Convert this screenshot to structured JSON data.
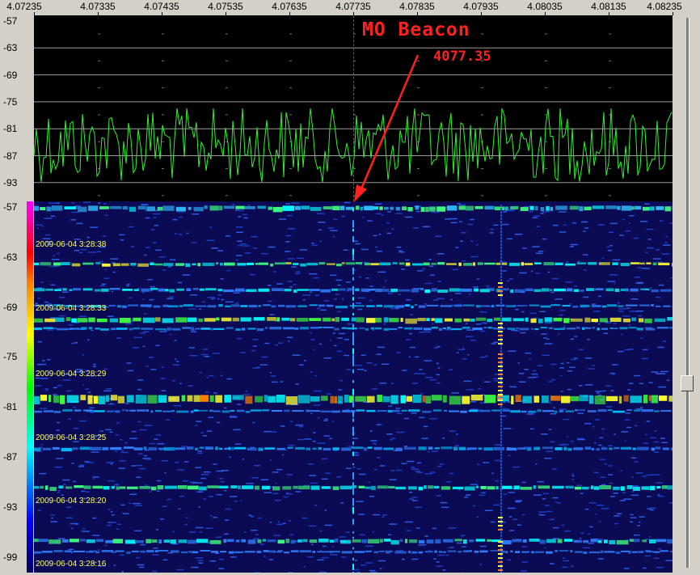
{
  "frequency_axis": {
    "labels": [
      "4.07235",
      "4.07335",
      "4.07435",
      "4.07535",
      "4.07635",
      "4.07735",
      "4.07835",
      "4.07935",
      "4.08035",
      "4.08135",
      "4.08235"
    ]
  },
  "spectrum_db_axis": {
    "labels": [
      "-57",
      "-63",
      "-69",
      "-75",
      "-81",
      "-87",
      "-93"
    ]
  },
  "waterfall_db_axis": {
    "labels": [
      "-57",
      "-63",
      "-69",
      "-75",
      "-81",
      "-87",
      "-93",
      "-99"
    ]
  },
  "timestamps": [
    "2009-06-04 3:28:38",
    "2009-06-04 3:28:33",
    "2009-06-04 3:28:29",
    "2009-06-04 3:28:25",
    "2009-06-04 3:28:20",
    "2009-06-04 3:28:16"
  ],
  "annotation": {
    "title": "MO Beacon",
    "frequency": "4077.35"
  },
  "colors": {
    "trace": "#33ee33",
    "annotation": "#ff2020",
    "timestamp": "#ffff60",
    "panel_background": "#d4d0c8"
  },
  "scrollbar": {
    "position": 0.67
  }
}
